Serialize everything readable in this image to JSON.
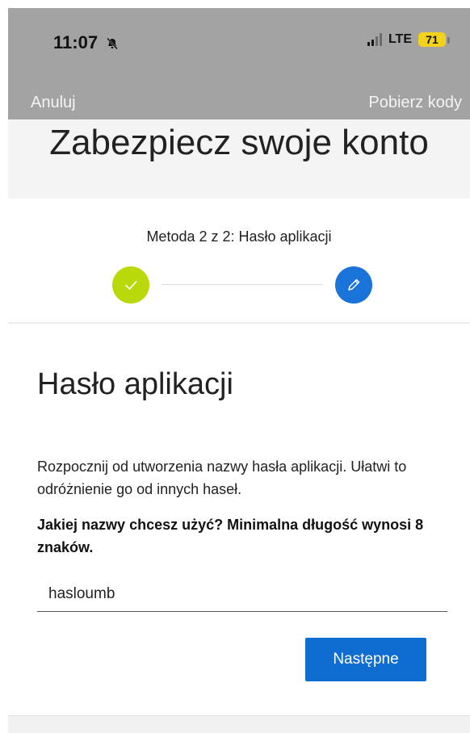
{
  "status_bar": {
    "time": "11:07",
    "network": "LTE",
    "battery": "71",
    "icons": [
      "muted-bell-icon",
      "signal-icon",
      "battery-icon"
    ]
  },
  "nav": {
    "cancel_label": "Anuluj",
    "codes_label": "Pobierz kody"
  },
  "page": {
    "title": "Zabezpiecz swoje konto"
  },
  "stepper": {
    "label": "Metoda 2 z 2: Hasło aplikacji",
    "steps": [
      {
        "state": "completed",
        "icon": "check-icon",
        "color": "#bad80a"
      },
      {
        "state": "current",
        "icon": "pencil-icon",
        "color": "#1a73d9"
      }
    ]
  },
  "section": {
    "title": "Hasło aplikacji",
    "description": "Rozpocznij od utworzenia nazwy hasła aplikacji. Ułatwi to odróżnienie go od innych haseł.",
    "question": "Jakiej nazwy chcesz użyć? Minimalna długość wynosi 8 znaków.",
    "input_value": "hasloumb",
    "next_label": "Następne"
  },
  "colors": {
    "top_bar": "#a3a3a3",
    "header_band": "#f4f4f4",
    "accent": "#0f6cd0",
    "success": "#bad80a"
  }
}
